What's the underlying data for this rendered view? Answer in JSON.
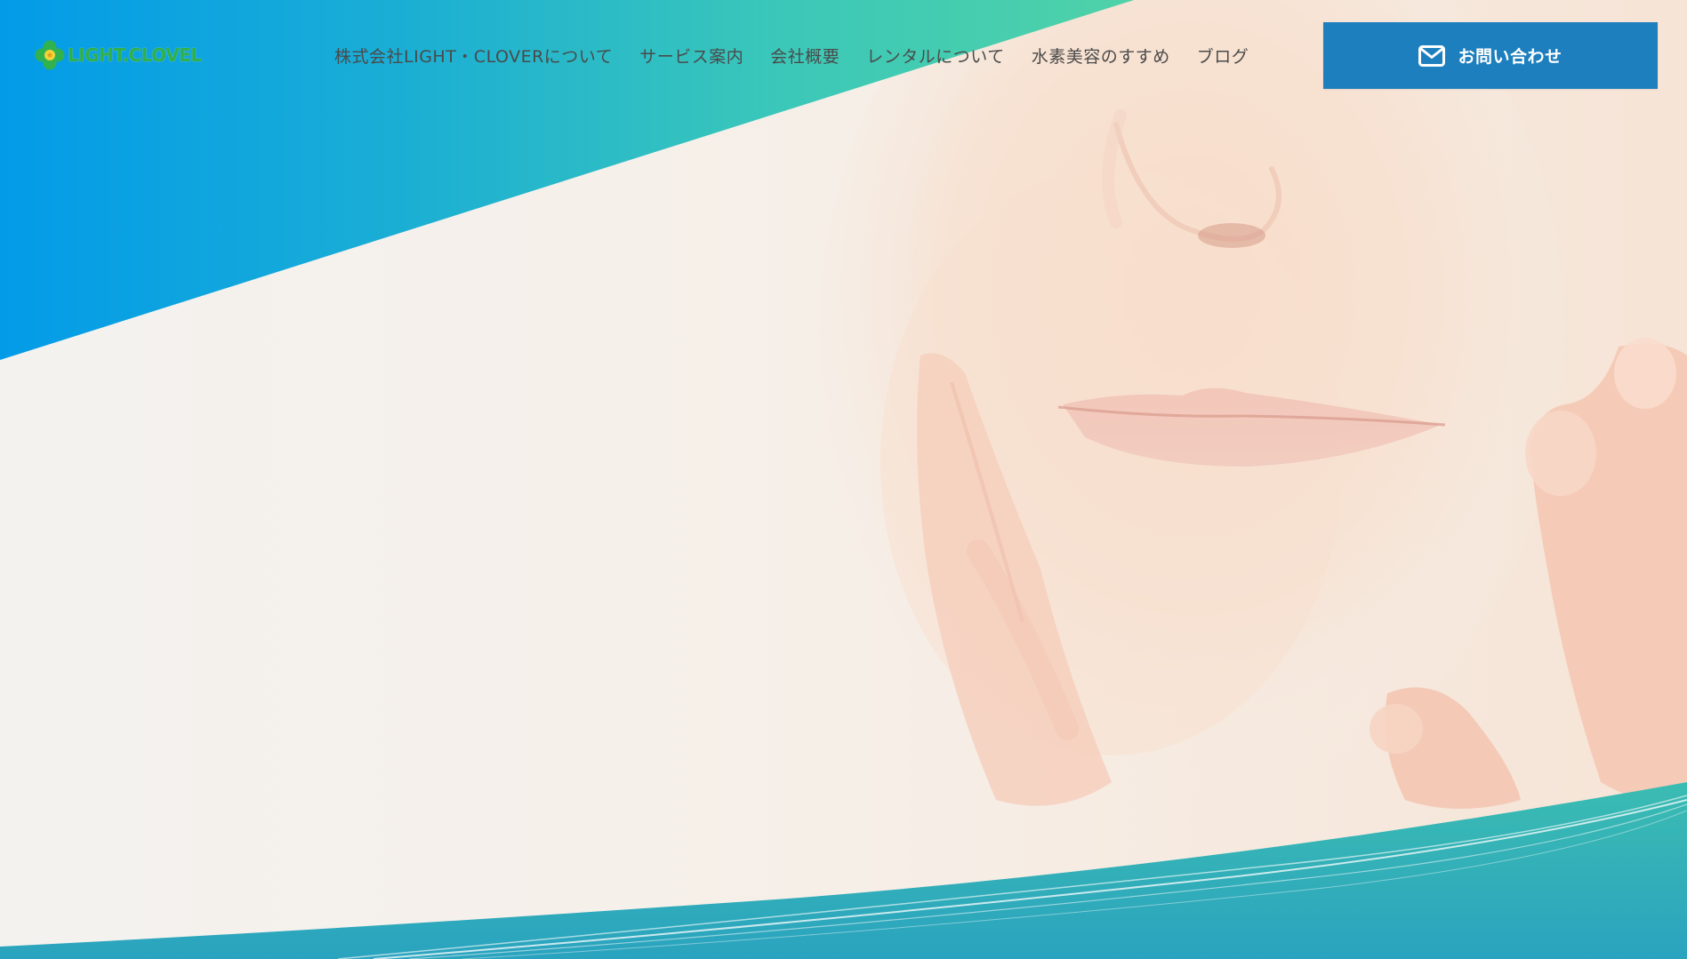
{
  "header": {
    "logo_text": "LIGHT.CLOVEL",
    "nav": [
      {
        "label": "株式会社LIGHT・CLOVERについて"
      },
      {
        "label": "サービス案内"
      },
      {
        "label": "会社概要"
      },
      {
        "label": "レンタルについて"
      },
      {
        "label": "水素美容のすすめ"
      },
      {
        "label": "ブログ"
      }
    ],
    "contact_button": {
      "label": "お問い合わせ",
      "icon": "envelope-icon"
    }
  },
  "hero": {
    "image": "woman-touching-face-photo"
  },
  "colors": {
    "brand_blue": "#1d7fbe",
    "gradient_blue": "#0596e6",
    "gradient_teal": "#44cdb0",
    "wave_teal": "#38b5b5",
    "logo_green": "#2fb04a",
    "nav_text": "#4a4a4a"
  }
}
